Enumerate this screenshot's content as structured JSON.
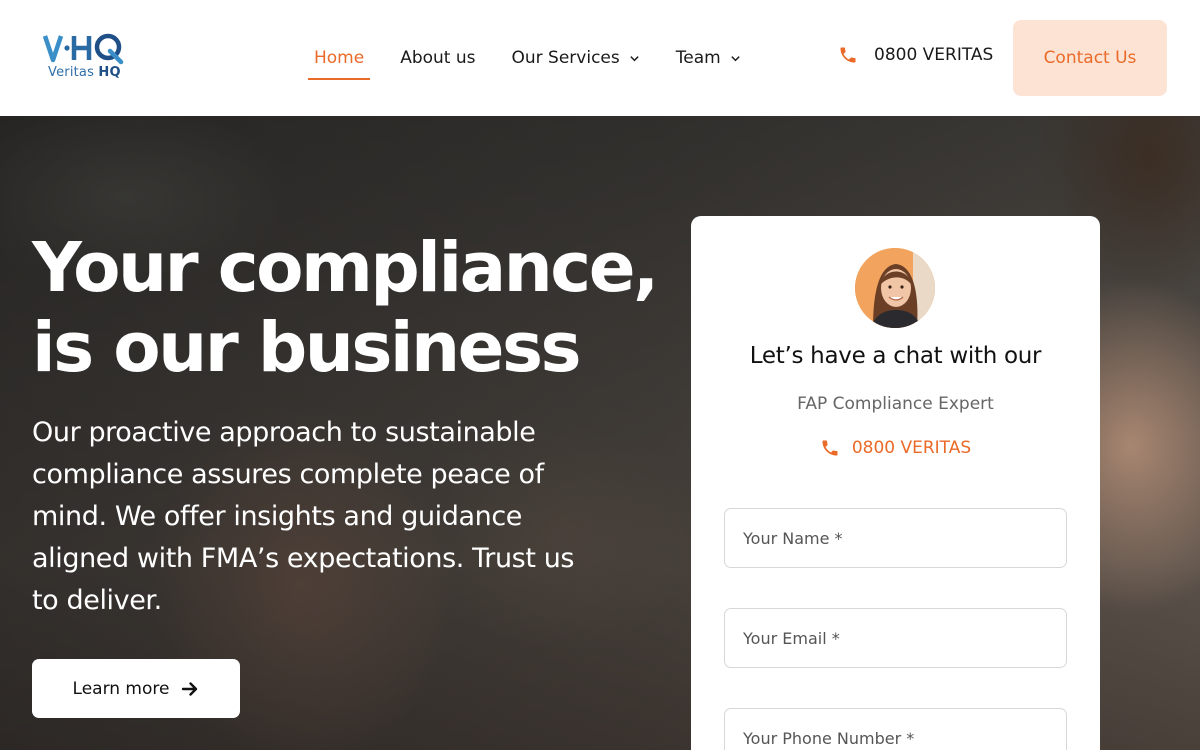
{
  "brand": {
    "logo_text_1": "Veritas",
    "logo_text_2": "HQ",
    "colors": {
      "accent": "#ea6a28",
      "accent_soft": "#fde3d4",
      "logo_blue": "#2f6ea8"
    }
  },
  "nav": {
    "items": [
      {
        "label": "Home",
        "active": true
      },
      {
        "label": "About us"
      },
      {
        "label": "Our Services",
        "dropdown": true
      },
      {
        "label": "Team",
        "dropdown": true
      }
    ],
    "phone": "0800 VERITAS",
    "contact_label": "Contact Us"
  },
  "hero": {
    "title_line1": "Your compliance,",
    "title_line2": "is our business",
    "text": "Our proactive approach to sustainable compliance assures complete peace of mind. We offer insights and guidance aligned with FMA’s expectations. Trust us to deliver.",
    "button_label": "Learn more"
  },
  "chat_card": {
    "title": "Let’s have a chat with our",
    "subtitle": "FAP Compliance Expert",
    "phone": "0800 VERITAS",
    "fields": {
      "name_placeholder": "Your Name *",
      "email_placeholder": "Your Email *",
      "phone_placeholder": "Your Phone Number *"
    }
  },
  "icons": [
    "phone-icon",
    "chevron-down-icon",
    "arrow-right-icon"
  ]
}
